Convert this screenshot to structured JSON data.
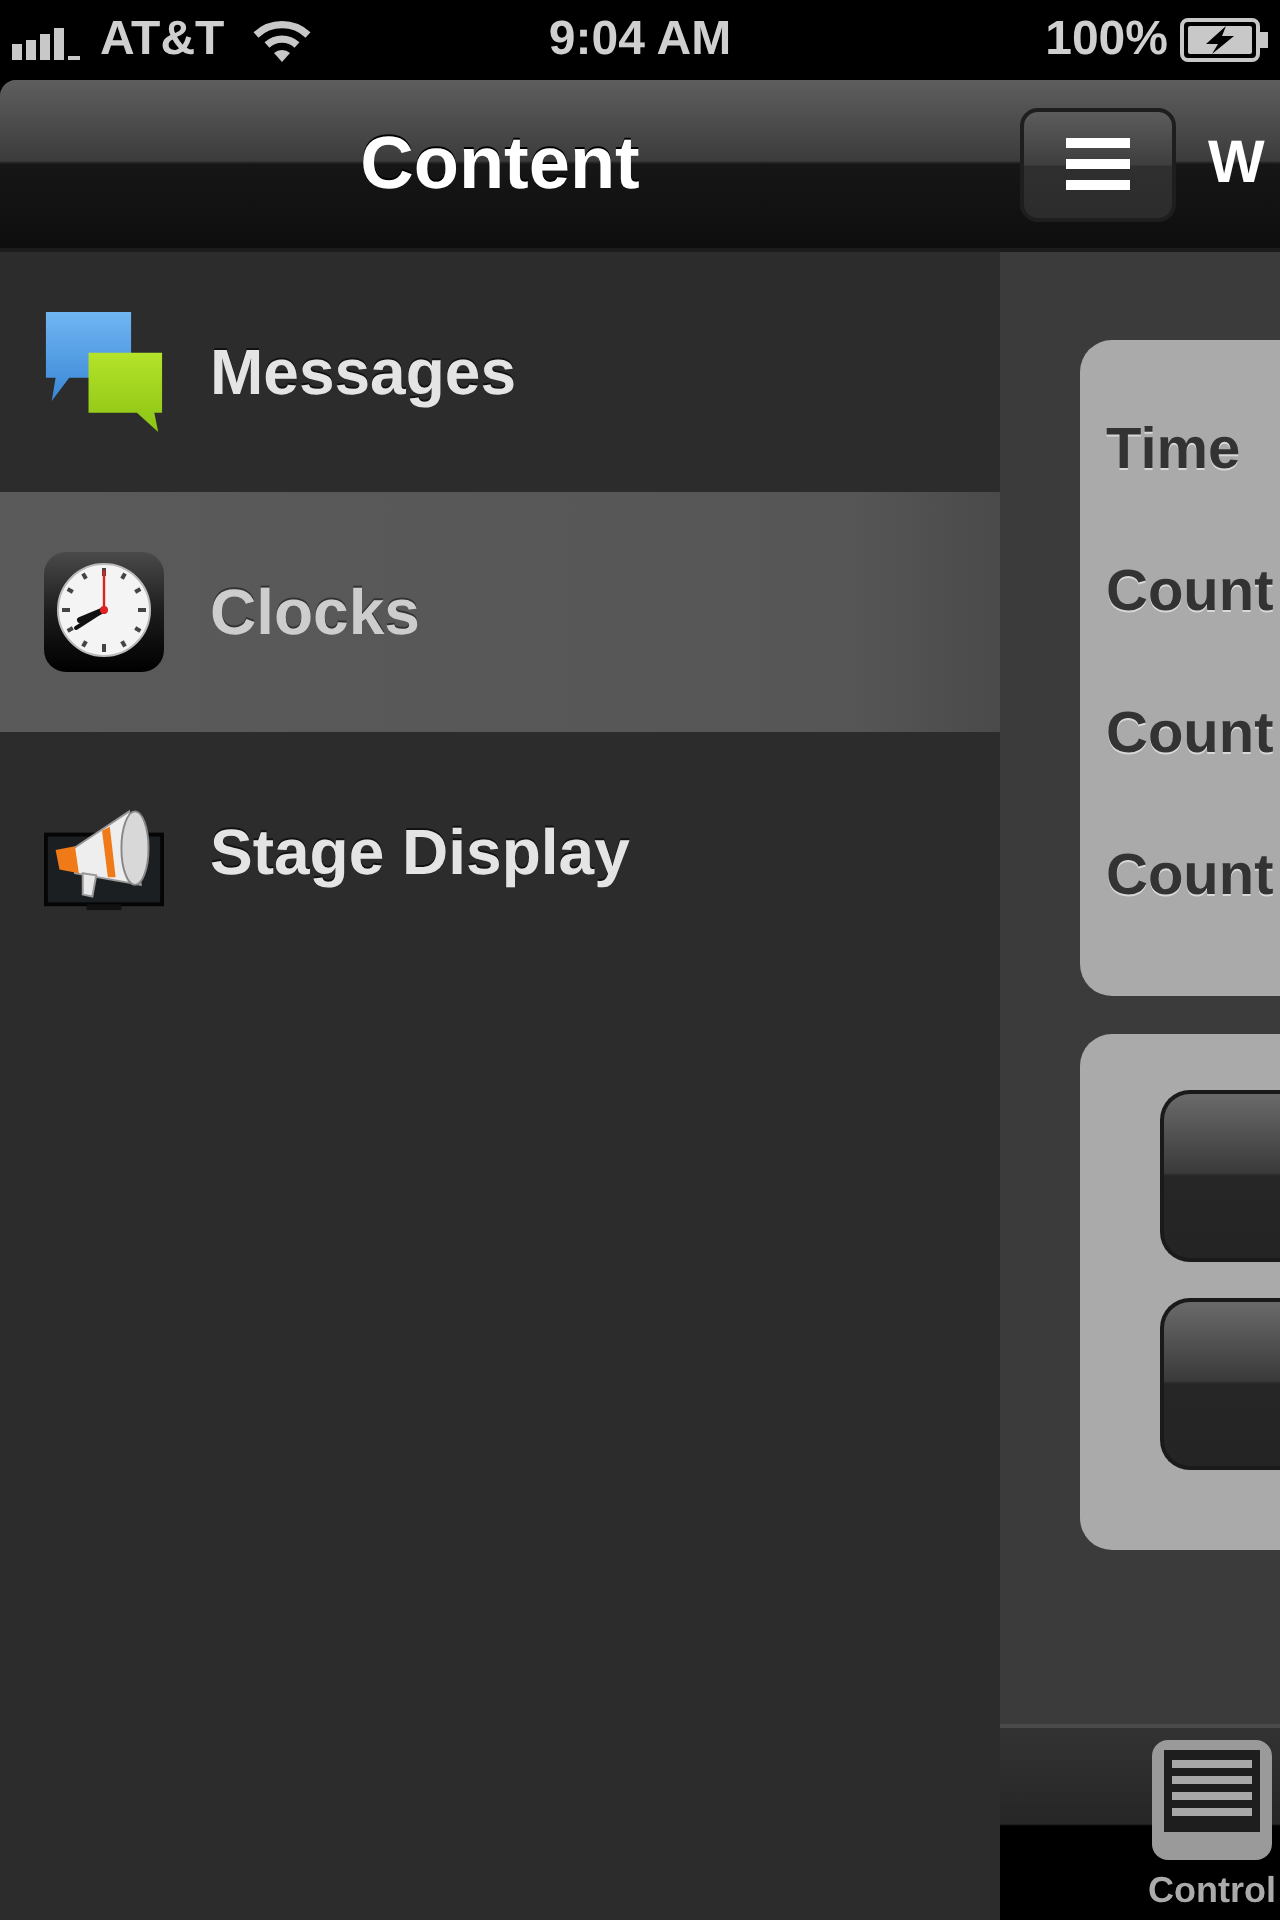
{
  "status_bar": {
    "carrier": "AT&T",
    "time": "9:04 AM",
    "battery": "100%"
  },
  "sidebar": {
    "title": "Content",
    "items": [
      {
        "label": "Messages",
        "kind": "messages",
        "selected": false
      },
      {
        "label": "Clocks",
        "kind": "clocks",
        "selected": true
      },
      {
        "label": "Stage Display",
        "kind": "stage",
        "selected": false
      }
    ]
  },
  "main": {
    "title": "W",
    "card_rows": [
      {
        "label": "Time"
      },
      {
        "label": "Count"
      },
      {
        "label": "Count"
      },
      {
        "label": "Count"
      }
    ]
  },
  "tab_bar": {
    "tabs": [
      {
        "label": "Control"
      }
    ]
  }
}
